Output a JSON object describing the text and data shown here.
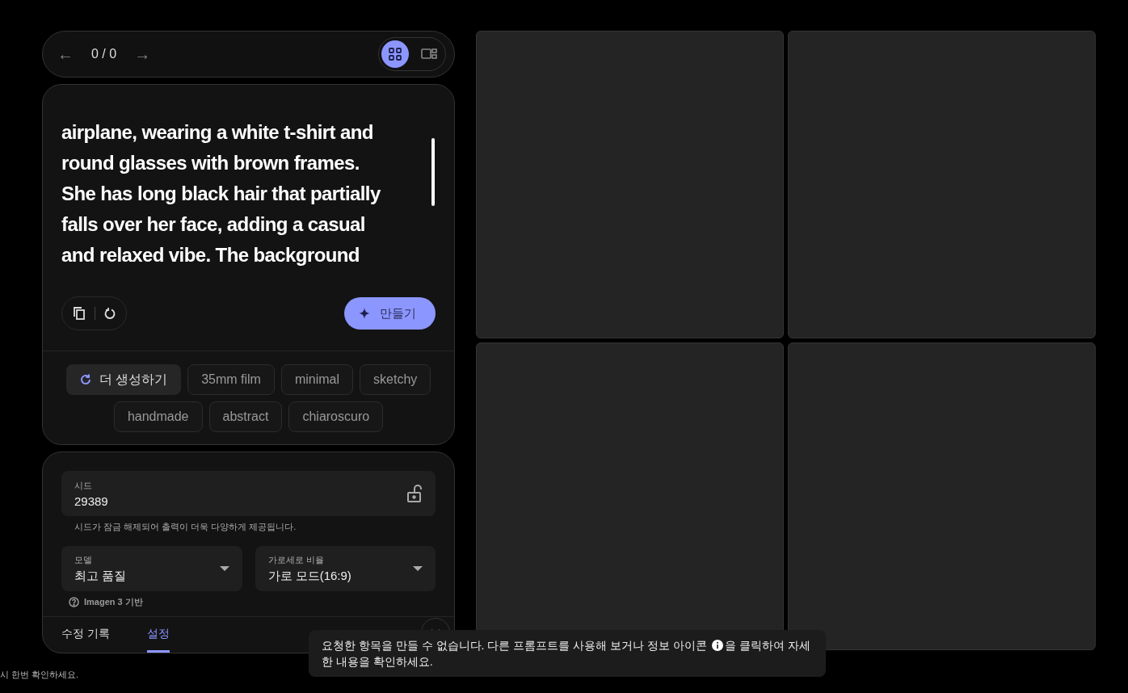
{
  "navigator": {
    "prev_arrow": "←",
    "counter": "0 / 0",
    "next_arrow": "→",
    "view_modes": [
      {
        "kind": "grid",
        "selected": true
      },
      {
        "kind": "single",
        "selected": false
      }
    ]
  },
  "prompt": {
    "lines": [
      "airplane, wearing a white t-shirt and",
      "round glasses with brown frames.",
      "She has long black hair that partially",
      "falls over her face, adding a casual",
      "and relaxed vibe. The background"
    ],
    "create_button": "만들기"
  },
  "suggestions": [
    {
      "kind": "more",
      "label": "더 생성하기"
    },
    {
      "kind": "chip",
      "label": "35mm film"
    },
    {
      "kind": "chip",
      "label": "minimal"
    },
    {
      "kind": "chip",
      "label": "sketchy"
    },
    {
      "kind": "chip",
      "label": "handmade"
    },
    {
      "kind": "chip",
      "label": "abstract"
    },
    {
      "kind": "chip",
      "label": "chiaroscuro"
    }
  ],
  "settings": {
    "seed": {
      "label": "시드",
      "value": "29389",
      "locked": false,
      "hint": "시드가 잠금 해제되어 출력이 더욱 다양하게 제공됩니다."
    },
    "selects": [
      {
        "label": "모델",
        "value": "최고 품질"
      },
      {
        "label": "가로세로 비율",
        "value": "가로 모드(16:9)"
      }
    ],
    "model_note": "Imagen 3 기반"
  },
  "tabs": [
    {
      "label": "수정 기록",
      "selected": false
    },
    {
      "label": "설정",
      "selected": true
    }
  ],
  "image_slots": [
    {
      "kind": "empty"
    },
    {
      "kind": "empty"
    },
    {
      "kind": "empty"
    },
    {
      "kind": "empty"
    }
  ],
  "toast": {
    "before_icon": "요청한 항목을 만들 수 없습니다. 다른 프롬프트를 사용해 보거나 정보 아이콘",
    "after_icon": "을 클릭하여 자세",
    "second_line": "한 내용을 확인하세요."
  },
  "footer_note": "시 한번 확인하세요."
}
